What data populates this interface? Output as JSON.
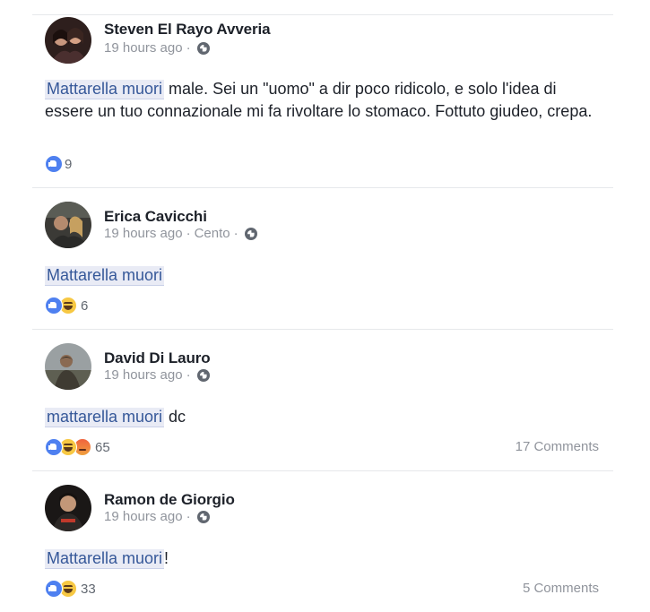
{
  "posts": [
    {
      "author": "Steven El Rayo Avveria",
      "time": "19 hours ago",
      "audience": "",
      "tag": "Mattarella muori",
      "text_rest": " male. Sei un \"uomo\" a dir poco ridicolo, e solo l'idea di essere un tuo connazionale mi fa rivoltare lo stomaco. Fottuto giudeo, crepa.",
      "reactions": [
        "like"
      ],
      "reaction_count": "9",
      "comments": ""
    },
    {
      "author": "Erica Cavicchi",
      "time": "19 hours ago",
      "audience": "Cento",
      "tag": "Mattarella muori",
      "text_rest": "",
      "reactions": [
        "like",
        "haha"
      ],
      "reaction_count": "6",
      "comments": ""
    },
    {
      "author": "David Di Lauro",
      "time": "19 hours ago",
      "audience": "",
      "tag": "mattarella muori",
      "text_rest": " dc",
      "reactions": [
        "like",
        "haha",
        "angry"
      ],
      "reaction_count": "65",
      "comments": "17 Comments"
    },
    {
      "author": "Ramon de Giorgio",
      "time": "19 hours ago",
      "audience": "",
      "tag": "Mattarella muori",
      "text_rest": "!",
      "reactions": [
        "like",
        "haha"
      ],
      "reaction_count": "33",
      "comments": "5 Comments"
    }
  ],
  "separator": "·",
  "icons": {
    "audience": "globe-icon",
    "reactions": {
      "like": "like-reaction-icon",
      "haha": "haha-reaction-icon",
      "angry": "angry-reaction-icon"
    }
  },
  "colors": {
    "tag_background": "#e9ebf5",
    "tag_text": "#365899",
    "like": "#4e80f0",
    "haha": "#f7c843",
    "angry": "#f0633e"
  }
}
